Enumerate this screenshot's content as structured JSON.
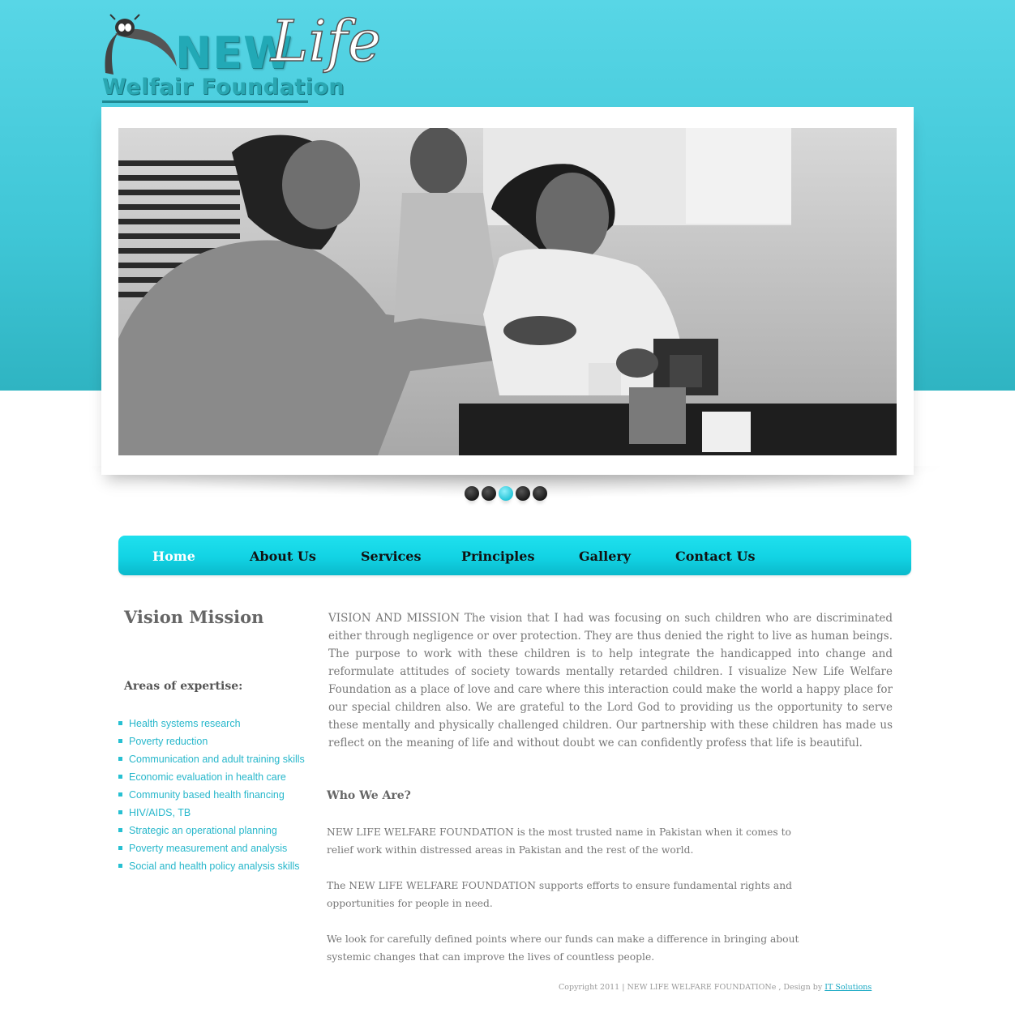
{
  "header": {
    "logo": {
      "line1": "NEW",
      "line2": "Life",
      "line3": "Welfair Foundation"
    }
  },
  "slider": {
    "image_alt": "Woman helping a boy stack building blocks",
    "dot_count": 5,
    "active_index": 2
  },
  "nav": {
    "items": [
      {
        "label": "Home",
        "current": true
      },
      {
        "label": "About Us"
      },
      {
        "label": "Services"
      },
      {
        "label": "Principles"
      },
      {
        "label": "Gallery"
      },
      {
        "label": "Contact Us"
      }
    ]
  },
  "sidebar": {
    "title": "Vision Mission",
    "areas_title": "Areas of expertise:",
    "areas": [
      "Health systems research",
      "Poverty reduction",
      "Communication and adult training skills",
      "Economic evaluation in health care",
      "Community based health financing",
      "HIV/AIDS, TB",
      "Strategic an operational planning",
      "Poverty measurement and analysis",
      "Social and health policy analysis skills"
    ]
  },
  "main": {
    "vision_text": "VISION AND MISSION The vision that I had was focusing on such children who are discriminated either through negligence or over protection. They are thus denied the right to live as human beings. The purpose to work with these children is to help integrate the handicapped into change and reformulate attitudes of society towards mentally retarded children. I visualize New Life Welfare Foundation as a place of love and care where this interaction could make the world a happy place for our special children also. We are grateful to the Lord God to providing us the opportunity to serve these mentally and physically challenged children. Our partnership with these children has made us reflect on the meaning of life and without doubt we can confidently profess that life is beautiful.",
    "who_title": "Who We Are?",
    "paragraphs": [
      "NEW LIFE WELFARE FOUNDATION is the most trusted name in Pakistan when it comes to relief work within distressed areas in Pakistan and the rest of the world.",
      "The NEW LIFE WELFARE FOUNDATION supports efforts to ensure fundamental rights and opportunities for people in need.",
      "We look for carefully defined points where our funds can make a difference in bringing about systemic changes that can improve the lives of countless people."
    ]
  },
  "footer": {
    "copyright": "Copyright 2011 | NEW LIFE WELFARE FOUNDATIONe , Design by",
    "designer_link": "IT Solutions"
  },
  "colors": {
    "accent": "#27c5d8",
    "header_band": "#4fcfdf",
    "nav": "#16d8e8",
    "link": "#27b7cb"
  }
}
